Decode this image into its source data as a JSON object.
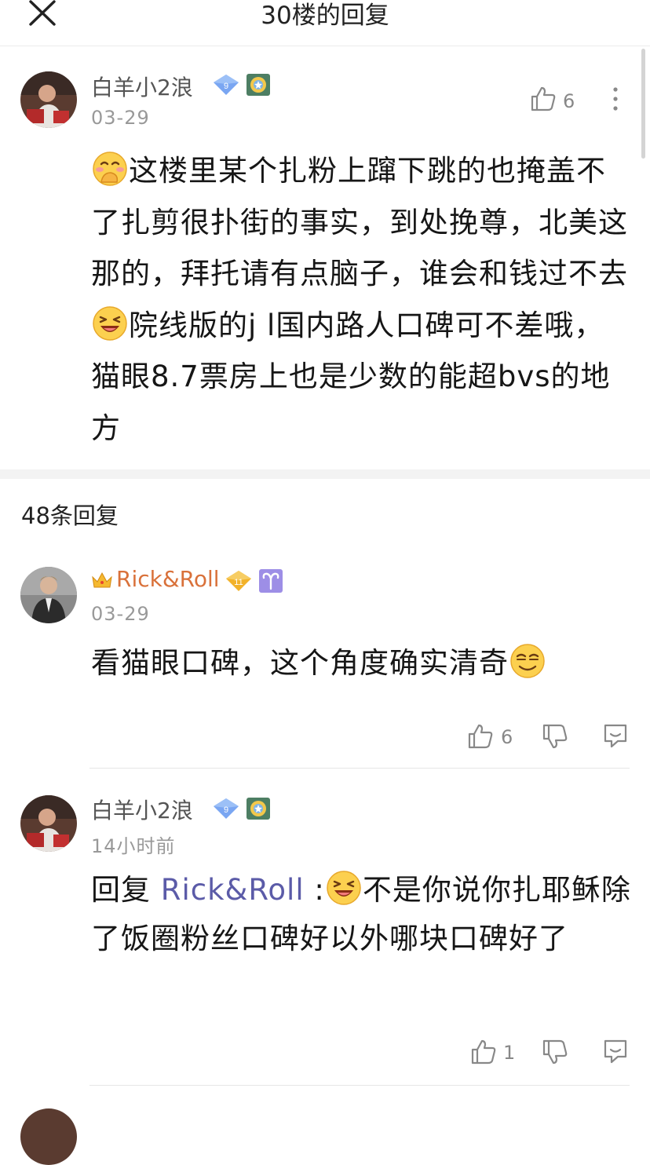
{
  "header": {
    "title": "30楼的回复",
    "close_icon": "close-icon"
  },
  "main_post": {
    "username": "白羊小2浪",
    "level": "9",
    "time": "03-29",
    "likes": "6",
    "text_1": "这楼里某个扎粉上蹿下跳的也掩盖不了扎剪很扑街的事实，到处挽尊，北美这那的，拜托请有点脑子，谁会和钱过不去",
    "text_2": "院线版的j l国内路人口碑可不差哦，猫眼8.7票房上也是少数的能超bvs的地方",
    "emoji_1": "cover-mouth-emoji",
    "emoji_2": "laughing-emoji"
  },
  "replies_header": "48条回复",
  "replies": [
    {
      "username": "Rick&Roll",
      "level": "11",
      "time": "03-29",
      "text": "看猫眼口碑，这个角度确实清奇",
      "likes": "6",
      "emoji": "smug-emoji"
    },
    {
      "username": "白羊小2浪",
      "level": "9",
      "time": "14小时前",
      "reply_prefix": "回复 ",
      "mention": "Rick&Roll",
      "colon": " :",
      "text": "不是你说你扎耶稣除了饭圈粉丝口碑好以外哪块口碑好了",
      "likes": "1",
      "emoji": "laughing-emoji"
    }
  ],
  "colors": {
    "accent_name": "#d9713a",
    "mention": "#5b5ba8",
    "level_badge": "#6b9cf0",
    "gold_badge": "#f0b52a"
  }
}
